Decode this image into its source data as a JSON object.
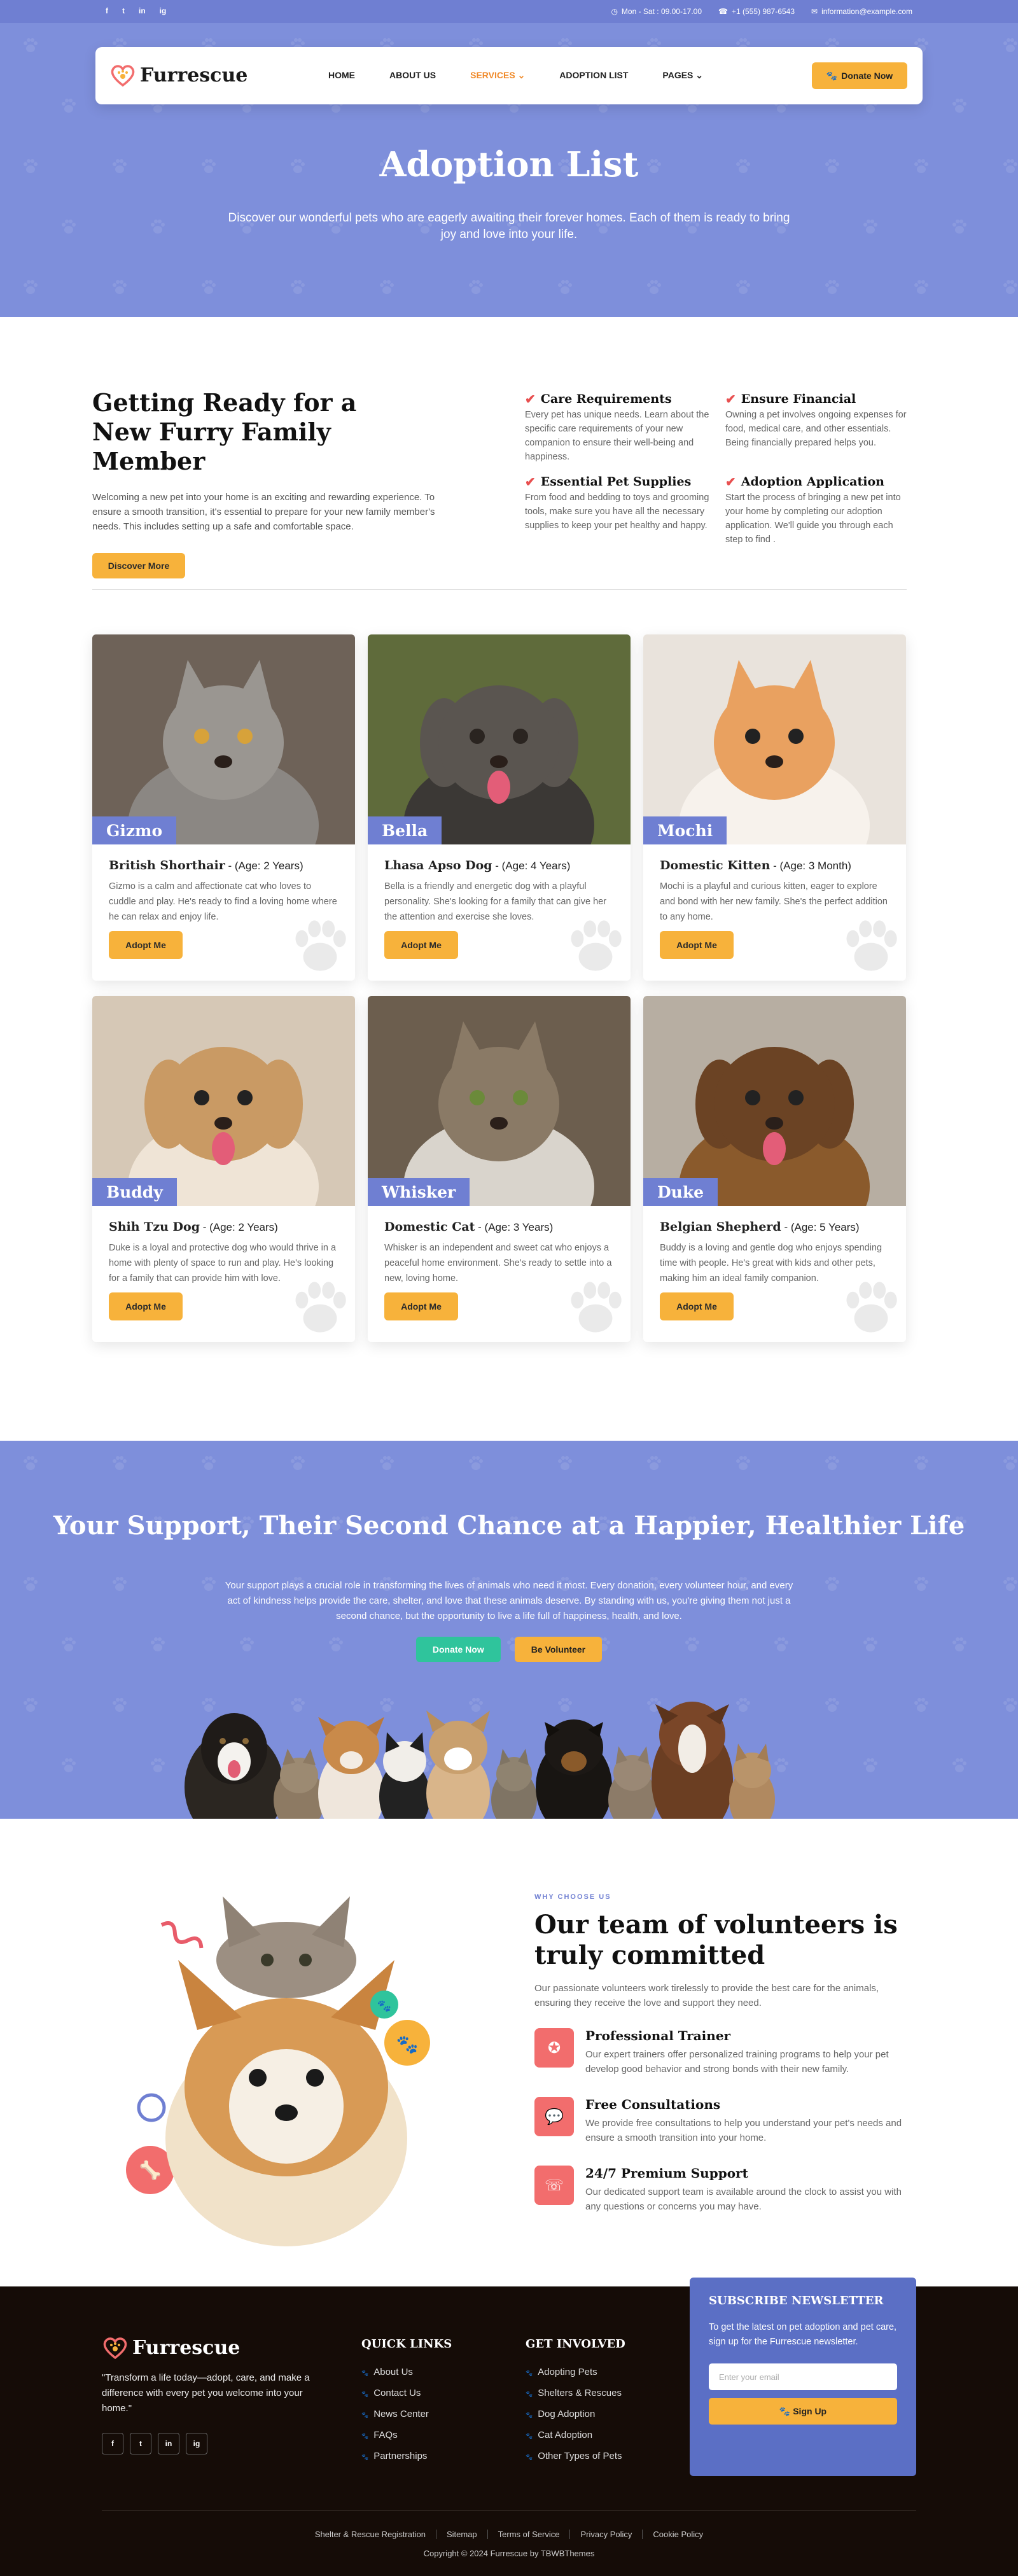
{
  "topbar": {
    "social": [
      "f",
      "t",
      "in",
      "ig"
    ],
    "hours": "Mon - Sat : 09.00-17.00",
    "phone": "+1 (555) 987-6543",
    "email": "information@example.com"
  },
  "brand": {
    "name": "Furrescue",
    "accent": "#6f7fd2",
    "orange": "#f7b23b",
    "red": "#f26d6d",
    "green": "#2fc49c"
  },
  "nav": {
    "items": [
      "HOME",
      "ABOUT US",
      "SERVICES",
      "ADOPTION LIST",
      "PAGES"
    ],
    "donate": "Donate Now"
  },
  "hero": {
    "title": "Adoption List",
    "subtitle": "Discover our wonderful pets who are eagerly awaiting their forever homes. Each of them is ready to bring joy and love into your life."
  },
  "ready": {
    "title": "Getting Ready for a New Furry Family Member",
    "intro": "Welcoming a new pet into your home is an exciting and rewarding experience. To ensure a smooth transition, it's essential to prepare for your new family member's needs. This includes setting up a safe and comfortable space.",
    "button": "Discover More",
    "features": [
      {
        "title": "Care Requirements",
        "text": "Every pet has unique needs. Learn about the specific care requirements of your new companion to ensure their well-being and happiness."
      },
      {
        "title": "Ensure Financial",
        "text": "Owning a pet involves ongoing expenses for food, medical care, and other essentials. Being financially prepared helps you."
      },
      {
        "title": "Essential Pet Supplies",
        "text": "From food and bedding to toys and grooming tools, make sure you have all the necessary supplies to keep your pet healthy and happy."
      },
      {
        "title": "Adoption Application",
        "text": "Start the process of bringing a new pet into your home by completing our adoption application. We'll guide you through each step to find ."
      }
    ]
  },
  "pets": [
    {
      "name": "Gizmo",
      "breed": "British Shorthair",
      "age": " - (Age: 2 Years)",
      "desc": "Gizmo is a calm and affectionate cat who loves to cuddle and play. He's ready to find a loving home where he can relax and enjoy life.",
      "button": "Adopt Me"
    },
    {
      "name": "Bella",
      "breed": "Lhasa Apso Dog",
      "age": " - (Age: 4 Years)",
      "desc": "Bella is a friendly and energetic dog with a playful personality. She's looking for a family that can give her the attention and exercise she loves.",
      "button": "Adopt Me"
    },
    {
      "name": "Mochi",
      "breed": "Domestic Kitten",
      "age": " - (Age: 3 Month)",
      "desc": "Mochi is a playful and curious kitten, eager to explore and bond with her new family. She's the perfect addition to any home.",
      "button": "Adopt Me"
    },
    {
      "name": "Buddy",
      "breed": "Shih Tzu Dog",
      "age": " - (Age: 2 Years)",
      "desc": "Duke is a loyal and protective dog who would thrive in a home with plenty of space to run and play. He's looking for a family that can provide him with love.",
      "button": "Adopt Me"
    },
    {
      "name": "Whisker",
      "breed": "Domestic Cat",
      "age": " - (Age: 3 Years)",
      "desc": "Whisker is an independent and sweet cat who enjoys a peaceful home environment. She's ready to settle into a new, loving home.",
      "button": "Adopt Me"
    },
    {
      "name": "Duke",
      "breed": "Belgian Shepherd",
      "age": " - (Age: 5 Years)",
      "desc": "Buddy is a loving and gentle dog who enjoys spending time with people. He's great with kids and other pets, making him an ideal family companion.",
      "button": "Adopt Me"
    }
  ],
  "support": {
    "title": "Your Support, Their Second Chance at a Happier, Healthier Life",
    "text": "Your support plays a crucial role in transforming the lives of animals who need it most. Every donation, every volunteer hour, and every act of kindness helps provide the care, shelter, and love that these animals deserve. By standing with us, you're giving them not just a second chance, but the opportunity to live a life full of happiness, health, and love.",
    "donate": "Donate Now",
    "volunteer": "Be Volunteer"
  },
  "volunteers": {
    "eyebrow": "WHY CHOOSE US",
    "title": "Our team of volunteers is truly committed",
    "lead": "Our passionate volunteers work tirelessly to provide the best care for the animals, ensuring they receive the love and support they need.",
    "services": [
      {
        "title": "Professional Trainer",
        "text": "Our expert trainers offer personalized training programs to help your pet develop good behavior and strong bonds with their new family.",
        "icon": "trainer-icon"
      },
      {
        "title": "Free Consultations",
        "text": "We provide free consultations to help you understand your pet's needs and ensure a smooth transition into your home.",
        "icon": "chat-icon"
      },
      {
        "title": "24/7 Premium Support",
        "text": "Our dedicated support team is available around the clock to assist you with any questions or concerns you may have.",
        "icon": "phone-icon"
      }
    ]
  },
  "footer": {
    "quote": "\"Transform a life today—adopt, care, and make a difference with every pet you welcome into your home.\"",
    "social": [
      "f",
      "t",
      "in",
      "ig"
    ],
    "quick_title": "QUICK LINKS",
    "quick_links": [
      "About Us",
      "Contact Us",
      "News Center",
      "FAQs",
      "Partnerships"
    ],
    "involved_title": "GET INVOLVED",
    "involved_links": [
      "Adopting Pets",
      "Shelters & Rescues",
      "Dog Adoption",
      "Cat Adoption",
      "Other Types of Pets"
    ],
    "newsletter": {
      "title": "SUBSCRIBE NEWSLETTER",
      "text": "To get the latest on pet adoption and pet care, sign up for the Furrescue newsletter.",
      "placeholder": "Enter your email",
      "button": "Sign Up"
    },
    "bottom_links": [
      "Shelter & Rescue Registration",
      "Sitemap",
      "Terms of Service",
      "Privacy Policy",
      "Cookie Policy"
    ],
    "copyright": "Copyright © 2024 Furrescue by TBWBThemes"
  }
}
